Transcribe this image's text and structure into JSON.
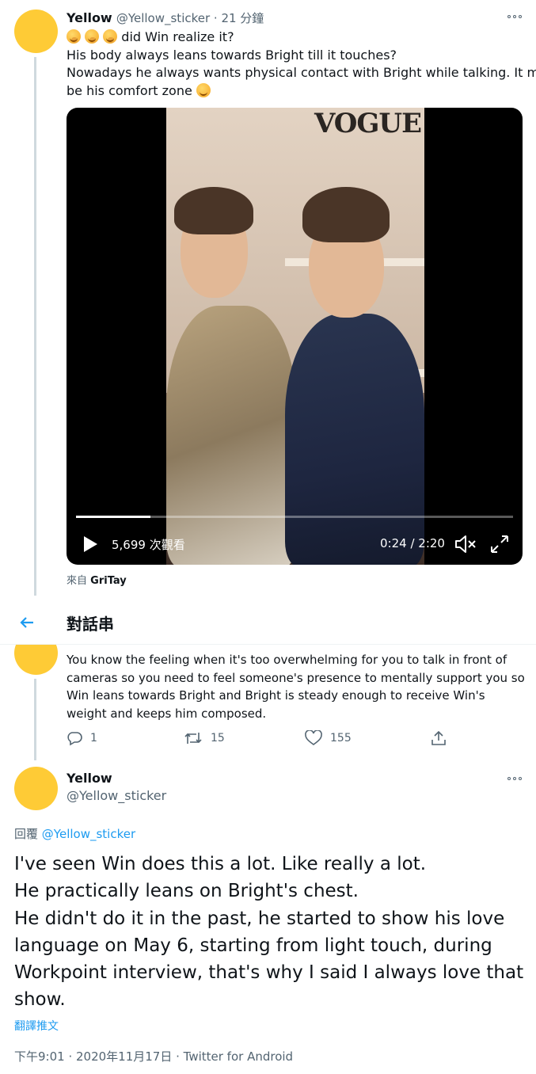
{
  "tweet1": {
    "name": "Yellow",
    "handle_time": "@Yellow_sticker · 21 分鐘",
    "line1": "did Win realize it?",
    "line2": "His body always leans towards Bright till it touches?",
    "line3": "Nowadays he always wants physical contact with Bright while talking. It must",
    "line4": "be his comfort zone",
    "video": {
      "watermark": "VOGUE",
      "views": "5,699 次觀看",
      "time": "0:24 / 2:20",
      "progress": 0.17
    },
    "source_prefix": "來自",
    "source_name": "GriTay"
  },
  "header": {
    "title": "對話串"
  },
  "tweet2": {
    "line1": "You know the feeling when it's too overwhelming for you to talk in front of",
    "line2": "cameras so you need to feel someone's presence to mentally support you so",
    "line3": "Win leans towards Bright and Bright is steady enough to receive Win's",
    "line4": "weight and keeps him composed.",
    "replies": "1",
    "retweets": "15",
    "likes": "155"
  },
  "tweet3": {
    "name": "Yellow",
    "handle": "@Yellow_sticker",
    "reply_prefix": "回覆",
    "reply_handle": "@Yellow_sticker",
    "line1": "I've seen Win does this a lot. Like really a lot.",
    "line2": "He practically leans on Bright's chest.",
    "line3": "He didn't do it in the past, he started to show his love",
    "line4": "language on May 6, starting from light touch, during",
    "line5": "Workpoint interview, that's why I said I always love that",
    "line6": "show.",
    "translate": "翻譯推文",
    "meta": "下午9:01 · 2020年11月17日 · Twitter for Android"
  },
  "colors": {
    "accent": "#1d9bf0",
    "avatar": "#fecb36",
    "muted": "#536471"
  }
}
